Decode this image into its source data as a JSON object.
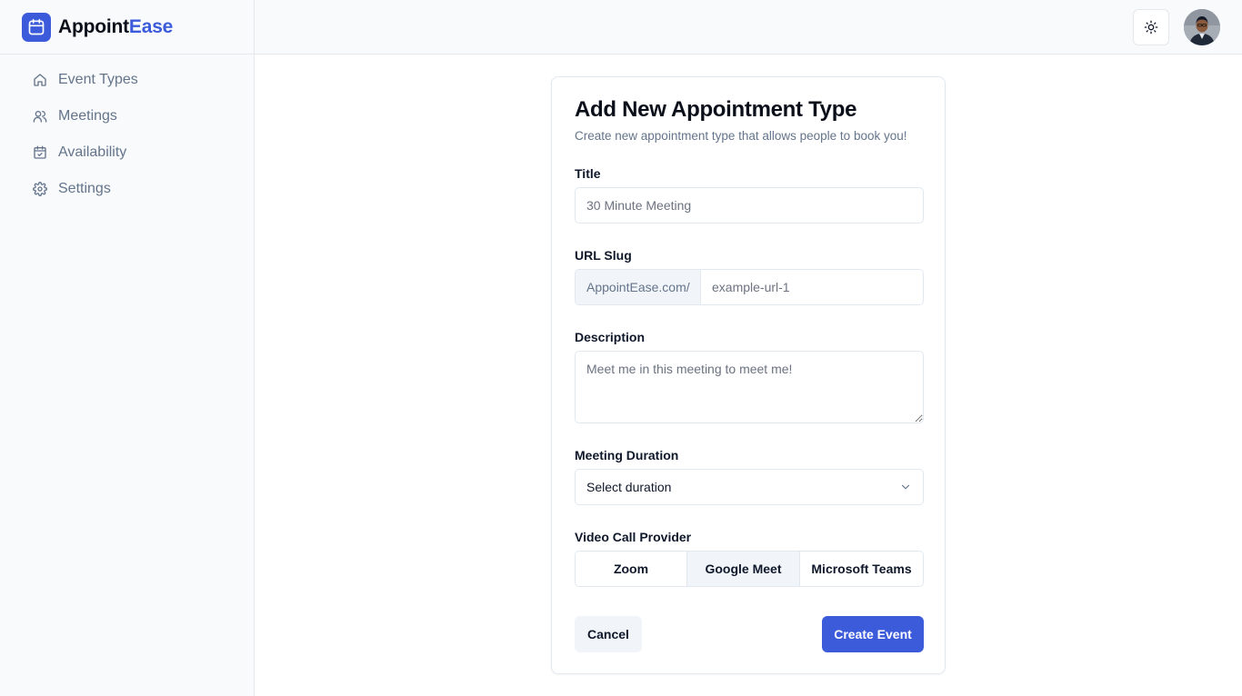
{
  "app": {
    "name_primary": "Appoint",
    "name_accent": "Ease",
    "logo_icon": "calendar-icon",
    "accent_color": "#3b5bdb"
  },
  "sidebar": {
    "items": [
      {
        "label": "Event Types",
        "icon": "home-icon"
      },
      {
        "label": "Meetings",
        "icon": "users-icon"
      },
      {
        "label": "Availability",
        "icon": "calendar-check-icon"
      },
      {
        "label": "Settings",
        "icon": "gear-icon"
      }
    ]
  },
  "header": {
    "theme_toggle_icon": "sun-icon",
    "avatar_icon": "user-avatar"
  },
  "form": {
    "title": "Add New Appointment Type",
    "subtitle": "Create new appointment type that allows people to book you!",
    "title_field": {
      "label": "Title",
      "placeholder": "30 Minute Meeting",
      "value": ""
    },
    "slug_field": {
      "label": "URL Slug",
      "prefix": "AppointEase.com/",
      "placeholder": "example-url-1",
      "value": ""
    },
    "description_field": {
      "label": "Description",
      "placeholder": "Meet me in this meeting to meet me!",
      "value": ""
    },
    "duration_field": {
      "label": "Meeting Duration",
      "selected": "Select duration"
    },
    "provider_field": {
      "label": "Video Call Provider",
      "options": [
        "Zoom",
        "Google Meet",
        "Microsoft Teams"
      ],
      "selected": "Google Meet"
    },
    "cancel_label": "Cancel",
    "submit_label": "Create Event"
  }
}
